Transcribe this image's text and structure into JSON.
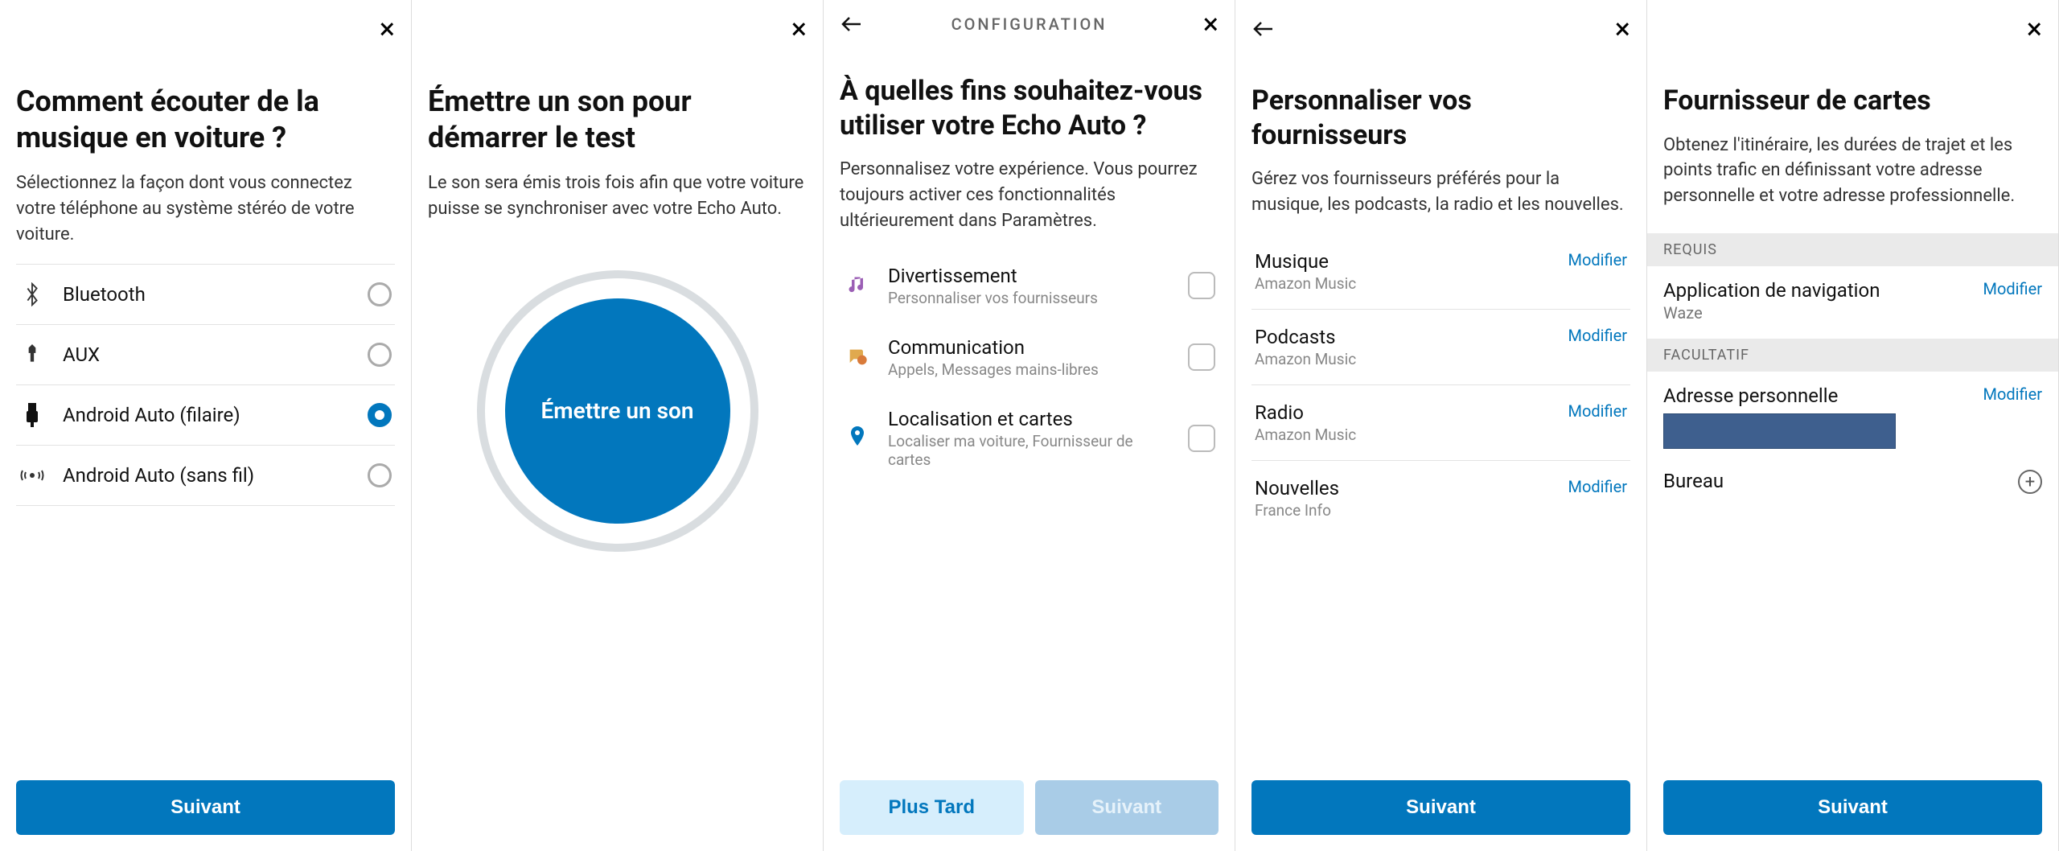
{
  "panel1": {
    "title": "Comment écouter de la musique en voiture ?",
    "subtitle": "Sélectionnez la façon dont vous connectez votre téléphone au système stéréo de votre voiture.",
    "options": [
      {
        "label": "Bluetooth",
        "selected": false
      },
      {
        "label": "AUX",
        "selected": false
      },
      {
        "label": "Android Auto (filaire)",
        "selected": true
      },
      {
        "label": "Android Auto (sans fil)",
        "selected": false
      }
    ],
    "next_label": "Suivant"
  },
  "panel2": {
    "title": "Émettre un son pour démarrer le test",
    "subtitle": "Le son sera émis trois fois afin que votre voiture puisse se synchroniser avec votre Echo Auto.",
    "button_label": "Émettre un son"
  },
  "panel3": {
    "header": "CONFIGURATION",
    "title": "À quelles fins souhaitez-vous utiliser votre Echo Auto ?",
    "subtitle": "Personnalisez votre expérience. Vous pourrez toujours activer ces fonctionnalités ultérieurement dans Paramètres.",
    "features": [
      {
        "title": "Divertissement",
        "subtitle": "Personnaliser vos fournisseurs"
      },
      {
        "title": "Communication",
        "subtitle": "Appels, Messages mains-libres"
      },
      {
        "title": "Localisation et cartes",
        "subtitle": "Localiser ma voiture, Fournisseur de cartes"
      }
    ],
    "later_label": "Plus Tard",
    "next_label": "Suivant"
  },
  "panel4": {
    "title": "Personnaliser vos fournisseurs",
    "subtitle": "Gérez vos fournisseurs préférés pour la musique, les podcasts, la radio et les nouvelles.",
    "providers": [
      {
        "title": "Musique",
        "subtitle": "Amazon Music"
      },
      {
        "title": "Podcasts",
        "subtitle": "Amazon Music"
      },
      {
        "title": "Radio",
        "subtitle": "Amazon Music"
      },
      {
        "title": "Nouvelles",
        "subtitle": "France Info"
      }
    ],
    "modify_label": "Modifier",
    "next_label": "Suivant"
  },
  "panel5": {
    "title": "Fournisseur de cartes",
    "subtitle": "Obtenez l'itinéraire, les durées de trajet et les points trafic en définissant votre adresse personnelle et votre adresse professionnelle.",
    "section_required": "REQUIS",
    "nav_app_label": "Application de navigation",
    "nav_app_value": "Waze",
    "section_optional": "FACULTATIF",
    "home_label": "Adresse personnelle",
    "office_label": "Bureau",
    "modify_label": "Modifier",
    "next_label": "Suivant"
  }
}
